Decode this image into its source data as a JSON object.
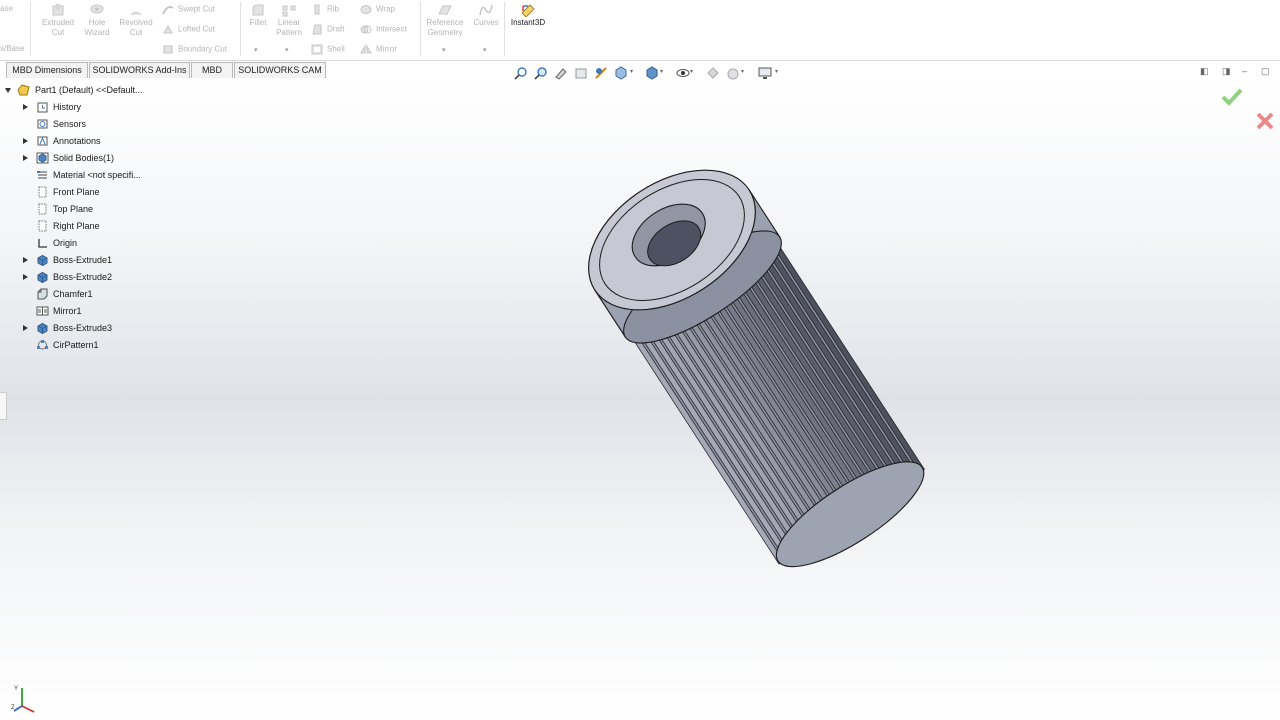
{
  "ribbon": {
    "partial_left_1": "ase",
    "partial_left_2": "s/Base",
    "extruded_cut": [
      "Extruded",
      "Cut"
    ],
    "hole_wizard": [
      "Hole",
      "Wizard"
    ],
    "revolved_cut": [
      "Revolved",
      "Cut"
    ],
    "swept_cut": "Swept Cut",
    "lofted_cut": "Lofted Cut",
    "boundary_cut": "Boundary Cut",
    "fillet": "Fillet",
    "linear_pattern": [
      "Linear",
      "Pattern"
    ],
    "rib": "Rib",
    "draft": "Draft",
    "shell": "Shell",
    "wrap": "Wrap",
    "intersect": "Intersect",
    "mirror": "Mirror",
    "reference_geometry": [
      "Reference",
      "Geometry"
    ],
    "curves": "Curves",
    "instant3d": "Instant3D"
  },
  "tabs": [
    "MBD Dimensions",
    "SOLIDWORKS Add-Ins",
    "MBD",
    "SOLIDWORKS CAM"
  ],
  "tree": {
    "root": "Part1 (Default) <<Default...",
    "items": [
      {
        "label": "History",
        "expandable": true,
        "icon": "history-icon"
      },
      {
        "label": "Sensors",
        "expandable": false,
        "icon": "sensors-icon"
      },
      {
        "label": "Annotations",
        "expandable": true,
        "icon": "annotations-icon"
      },
      {
        "label": "Solid Bodies(1)",
        "expandable": true,
        "icon": "solid-bodies-icon"
      },
      {
        "label": "Material <not specifi...",
        "expandable": false,
        "icon": "material-icon"
      },
      {
        "label": "Front Plane",
        "expandable": false,
        "icon": "plane-icon"
      },
      {
        "label": "Top Plane",
        "expandable": false,
        "icon": "plane-icon"
      },
      {
        "label": "Right Plane",
        "expandable": false,
        "icon": "plane-icon"
      },
      {
        "label": "Origin",
        "expandable": false,
        "icon": "origin-icon"
      },
      {
        "label": "Boss-Extrude1",
        "expandable": true,
        "icon": "boss-extrude-icon"
      },
      {
        "label": "Boss-Extrude2",
        "expandable": true,
        "icon": "boss-extrude-icon"
      },
      {
        "label": "Chamfer1",
        "expandable": false,
        "icon": "chamfer-icon"
      },
      {
        "label": "Mirror1",
        "expandable": false,
        "icon": "mirror-icon"
      },
      {
        "label": "Boss-Extrude3",
        "expandable": true,
        "icon": "boss-extrude-icon"
      },
      {
        "label": "CirPattern1",
        "expandable": false,
        "icon": "circular-pattern-icon"
      }
    ]
  },
  "triad": {
    "y": "Y",
    "z": "Z"
  },
  "colors": {
    "accent_blue": "#3a7bbf",
    "confirm_green": "#8fd27e",
    "cancel_red": "#e88a8a",
    "part_body": "#8e93a4"
  }
}
